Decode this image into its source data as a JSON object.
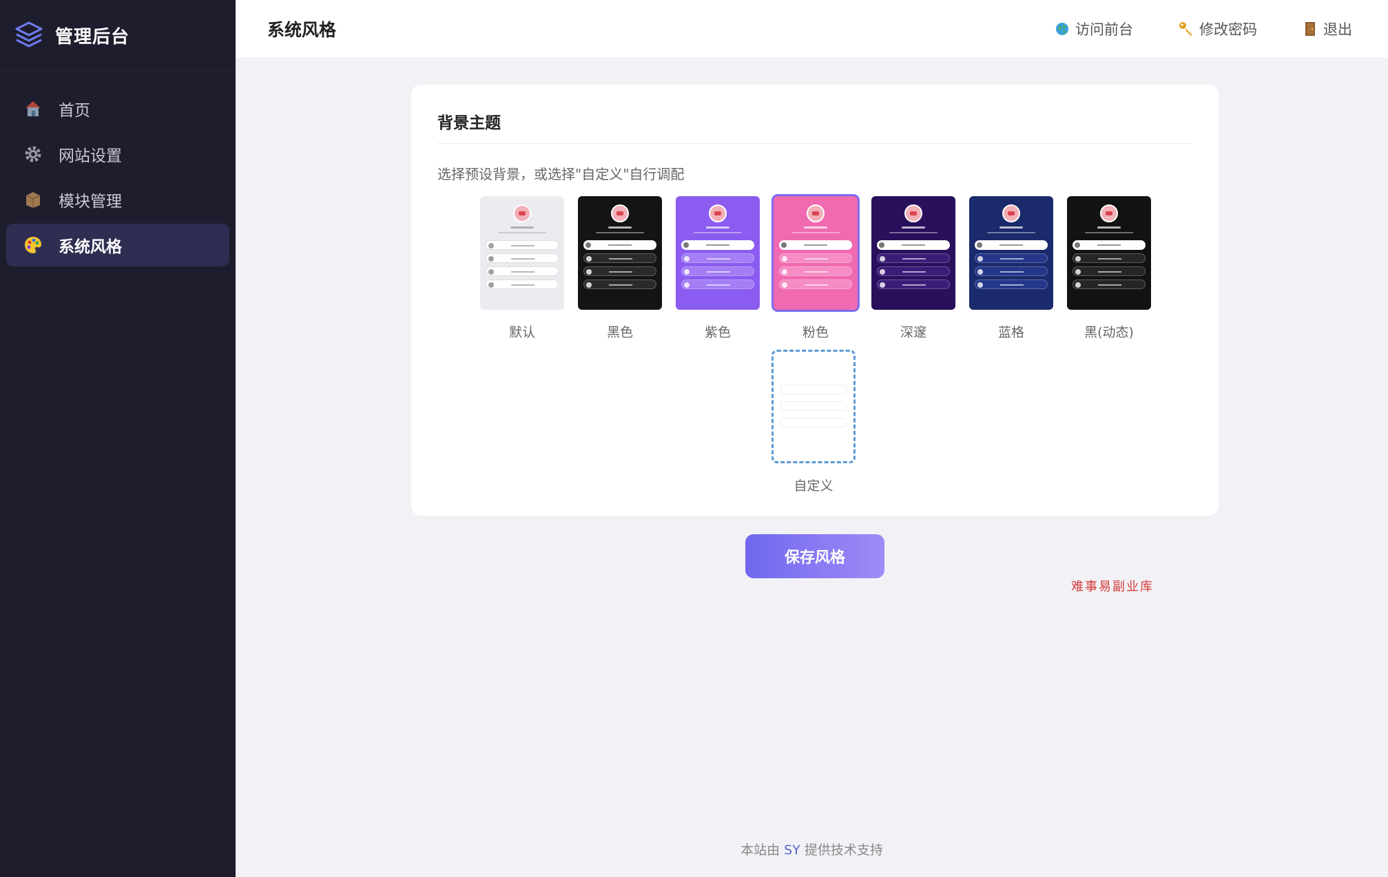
{
  "sidebar": {
    "title": "管理后台",
    "items": [
      {
        "label": "首页",
        "icon": "house-icon"
      },
      {
        "label": "网站设置",
        "icon": "gear-icon"
      },
      {
        "label": "模块管理",
        "icon": "box-icon"
      },
      {
        "label": "系统风格",
        "icon": "palette-icon",
        "active": true
      }
    ]
  },
  "header": {
    "title": "系统风格",
    "actions": [
      {
        "label": "访问前台",
        "icon": "globe-icon"
      },
      {
        "label": "修改密码",
        "icon": "key-icon"
      },
      {
        "label": "退出",
        "icon": "door-icon"
      }
    ]
  },
  "card": {
    "title": "背景主题",
    "description": "选择预设背景，或选择\"自定义\"自行调配",
    "themes": [
      {
        "label": "默认",
        "bg": "#ececf0",
        "row": "#ffffff",
        "selected": false
      },
      {
        "label": "黑色",
        "bg": "#141414",
        "row": "#2a2a2a",
        "selected": false
      },
      {
        "label": "紫色",
        "bg": "#8b5cf0",
        "row": "#a37ef5",
        "selected": false
      },
      {
        "label": "粉色",
        "bg": "#f06ab0",
        "row": "#f58cc4",
        "selected": true
      },
      {
        "label": "深邃",
        "bg": "#2a0f5c",
        "row": "#3b1d78",
        "selected": false
      },
      {
        "label": "蓝格",
        "bg": "#1b2a6b",
        "row": "#25378a",
        "selected": false
      },
      {
        "label": "黑(动态)",
        "bg": "#121212",
        "row": "#262626",
        "selected": false
      }
    ],
    "custom_label": "自定义"
  },
  "save_label": "保存风格",
  "watermark": "难事易副业库",
  "footer": {
    "prefix": "本站由 ",
    "brand": "SY",
    "suffix": " 提供技术支持"
  },
  "colors": {
    "accent": "#7c6cf0",
    "sidebar_bg": "#1d1d2e"
  }
}
